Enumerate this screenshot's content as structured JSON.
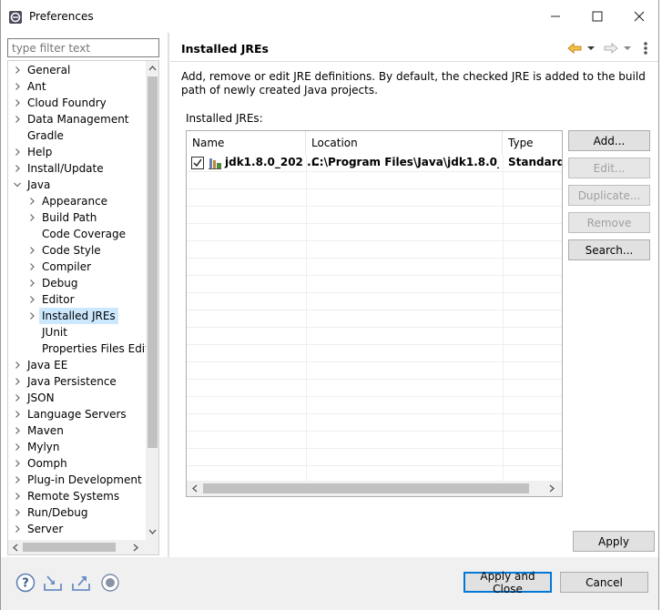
{
  "window": {
    "title": "Preferences"
  },
  "filter": {
    "placeholder": "type filter text"
  },
  "tree": {
    "items": [
      {
        "label": "General",
        "level": 0,
        "twisty": "collapsed"
      },
      {
        "label": "Ant",
        "level": 0,
        "twisty": "collapsed"
      },
      {
        "label": "Cloud Foundry",
        "level": 0,
        "twisty": "collapsed"
      },
      {
        "label": "Data Management",
        "level": 0,
        "twisty": "collapsed"
      },
      {
        "label": "Gradle",
        "level": 0,
        "twisty": "none"
      },
      {
        "label": "Help",
        "level": 0,
        "twisty": "collapsed"
      },
      {
        "label": "Install/Update",
        "level": 0,
        "twisty": "collapsed"
      },
      {
        "label": "Java",
        "level": 0,
        "twisty": "expanded"
      },
      {
        "label": "Appearance",
        "level": 1,
        "twisty": "collapsed"
      },
      {
        "label": "Build Path",
        "level": 1,
        "twisty": "collapsed"
      },
      {
        "label": "Code Coverage",
        "level": 1,
        "twisty": "none"
      },
      {
        "label": "Code Style",
        "level": 1,
        "twisty": "collapsed"
      },
      {
        "label": "Compiler",
        "level": 1,
        "twisty": "collapsed"
      },
      {
        "label": "Debug",
        "level": 1,
        "twisty": "collapsed"
      },
      {
        "label": "Editor",
        "level": 1,
        "twisty": "collapsed"
      },
      {
        "label": "Installed JREs",
        "level": 1,
        "twisty": "collapsed",
        "selected": true
      },
      {
        "label": "JUnit",
        "level": 1,
        "twisty": "none"
      },
      {
        "label": "Properties Files Editor",
        "level": 1,
        "twisty": "none"
      },
      {
        "label": "Java EE",
        "level": 0,
        "twisty": "collapsed"
      },
      {
        "label": "Java Persistence",
        "level": 0,
        "twisty": "collapsed"
      },
      {
        "label": "JSON",
        "level": 0,
        "twisty": "collapsed"
      },
      {
        "label": "Language Servers",
        "level": 0,
        "twisty": "collapsed"
      },
      {
        "label": "Maven",
        "level": 0,
        "twisty": "collapsed"
      },
      {
        "label": "Mylyn",
        "level": 0,
        "twisty": "collapsed"
      },
      {
        "label": "Oomph",
        "level": 0,
        "twisty": "collapsed"
      },
      {
        "label": "Plug-in Development",
        "level": 0,
        "twisty": "collapsed"
      },
      {
        "label": "Remote Systems",
        "level": 0,
        "twisty": "collapsed"
      },
      {
        "label": "Run/Debug",
        "level": 0,
        "twisty": "collapsed"
      },
      {
        "label": "Server",
        "level": 0,
        "twisty": "collapsed"
      }
    ]
  },
  "page": {
    "title": "Installed JREs",
    "description": "Add, remove or edit JRE definitions. By default, the checked JRE is added to the build path of newly created Java projects.",
    "list_label": "Installed JREs:"
  },
  "table": {
    "columns": [
      "Name",
      "Location",
      "Type"
    ],
    "rows": [
      {
        "checked": true,
        "name": "jdk1.8.0_202 ...",
        "location": "C:\\Program Files\\Java\\jdk1.8.0_...",
        "type": "Standard"
      }
    ]
  },
  "buttons": {
    "add": "Add...",
    "edit": "Edit...",
    "duplicate": "Duplicate...",
    "remove": "Remove",
    "search": "Search...",
    "apply": "Apply",
    "apply_close": "Apply and Close",
    "cancel": "Cancel"
  },
  "icons": [
    "eclipse-icon",
    "minimize-icon",
    "maximize-icon",
    "close-icon",
    "back-icon",
    "forward-icon",
    "menu-icon",
    "help-icon",
    "import-icon",
    "export-icon",
    "record-icon",
    "jre-library-icon",
    "checkbox-icon"
  ],
  "colors": {
    "selection": "#cce8ff",
    "nav_arrow": "#e8a317",
    "focus_border": "#0078d7"
  }
}
